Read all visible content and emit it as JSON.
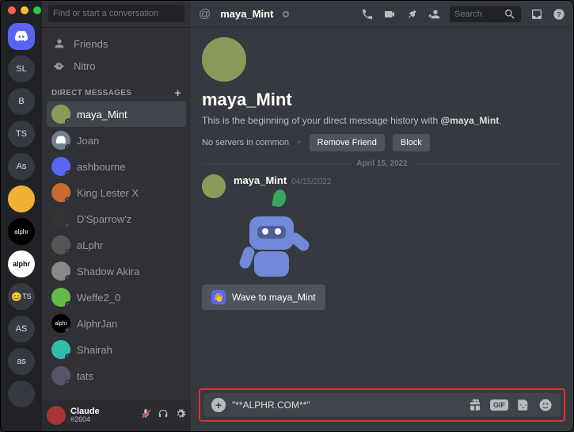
{
  "search_placeholder": "Find or start a conversation",
  "nav": {
    "friends": "Friends",
    "nitro": "Nitro"
  },
  "dm_header": "DIRECT MESSAGES",
  "guilds": [
    {
      "id": "discord",
      "label": ""
    },
    {
      "id": "sl",
      "label": "SL"
    },
    {
      "id": "b",
      "label": "B"
    },
    {
      "id": "ts",
      "label": "TS"
    },
    {
      "id": "as",
      "label": "As"
    },
    {
      "id": "pill",
      "label": ""
    },
    {
      "id": "alphr-dark",
      "label": "alphr"
    },
    {
      "id": "alphr-light",
      "label": "alphr"
    },
    {
      "id": "ts2",
      "label": "TS"
    },
    {
      "id": "as2",
      "label": "AS"
    },
    {
      "id": "as3",
      "label": "as"
    }
  ],
  "dms": [
    {
      "name": "maya_Mint",
      "active": true,
      "avatar": "yoda"
    },
    {
      "name": "Joan",
      "avatar": "gray"
    },
    {
      "name": "ashbourne",
      "avatar": "p1"
    },
    {
      "name": "King Lester X",
      "avatar": "p2"
    },
    {
      "name": "D'Sparrow'z",
      "avatar": "p3"
    },
    {
      "name": "aLphr",
      "avatar": "p4"
    },
    {
      "name": "Shadow Akira",
      "avatar": "p5"
    },
    {
      "name": "Weffe2_0",
      "avatar": "p6"
    },
    {
      "name": "AlphrJan",
      "avatar": "p7"
    },
    {
      "name": "Shairah",
      "avatar": "p8"
    },
    {
      "name": "tats",
      "avatar": "p9"
    }
  ],
  "me": {
    "name": "Claude",
    "tag": "#2604"
  },
  "topbar": {
    "name": "maya_Mint",
    "search": "Search"
  },
  "header": {
    "name": "maya_Mint",
    "subtitle_pre": "This is the beginning of your direct message history with ",
    "subtitle_mention": "@maya_Mint",
    "subtitle_post": ".",
    "no_servers": "No servers in common",
    "remove": "Remove Friend",
    "block": "Block"
  },
  "divider_date": "April 15, 2022",
  "message": {
    "author": "maya_Mint",
    "time": "04/15/2022"
  },
  "wave": "Wave to maya_Mint",
  "input_value": "\"**ALPHR.COM**\"",
  "gif": "GIF"
}
